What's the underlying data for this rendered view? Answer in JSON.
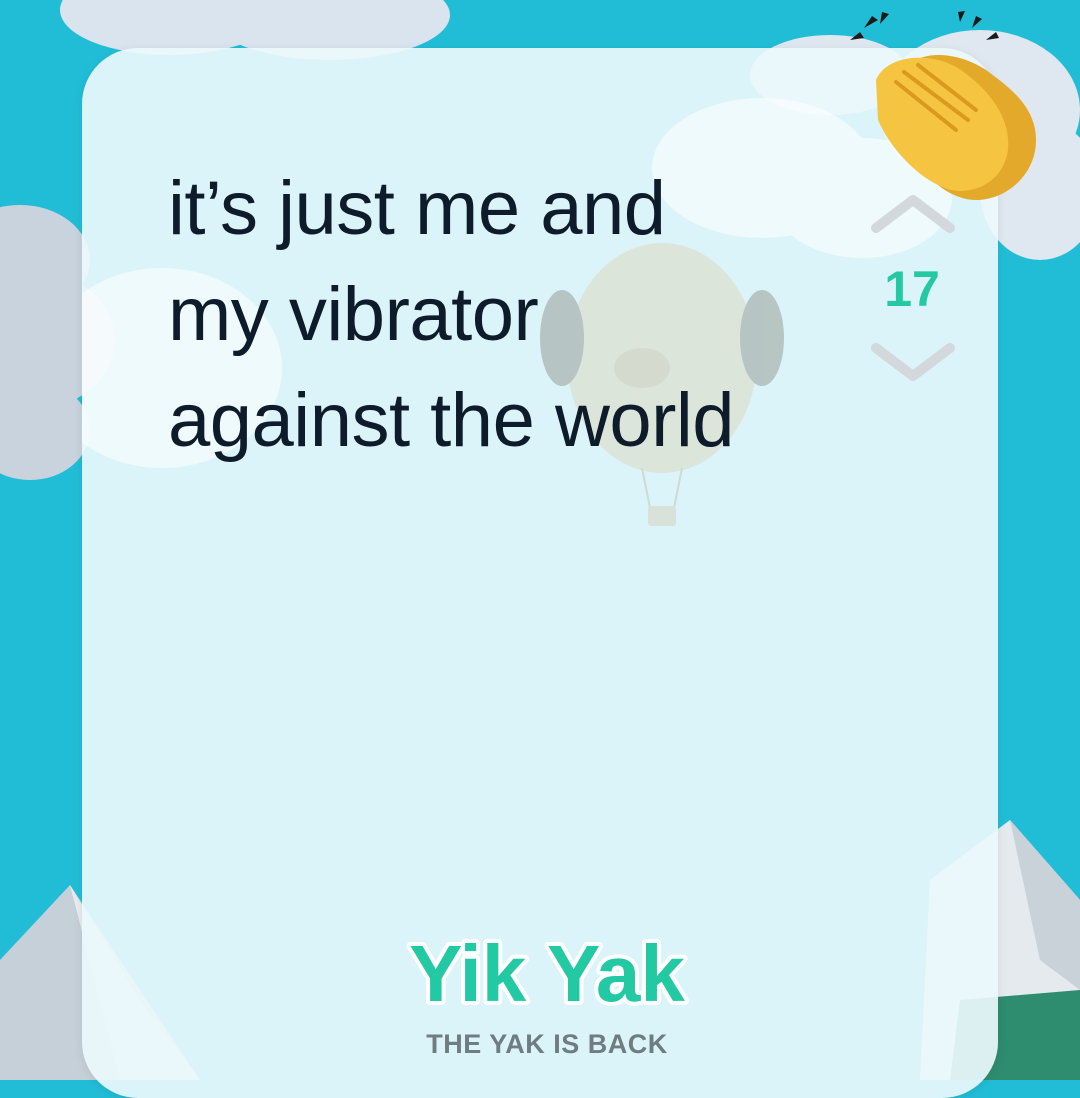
{
  "post": {
    "lines": [
      "it’s just me and",
      "my vibrator",
      "against the world"
    ]
  },
  "vote": {
    "count": "17",
    "upvote_icon": "chevron-up-icon",
    "downvote_icon": "chevron-down-icon",
    "count_color": "#22c9a3"
  },
  "brand": {
    "logo_text": "Yik Yak",
    "tagline": "THE YAK IS BACK",
    "logo_color": "#22c9a3"
  },
  "decor": {
    "reaction_icon": "clapping-hands-icon",
    "background_color": "#21bdd6"
  }
}
